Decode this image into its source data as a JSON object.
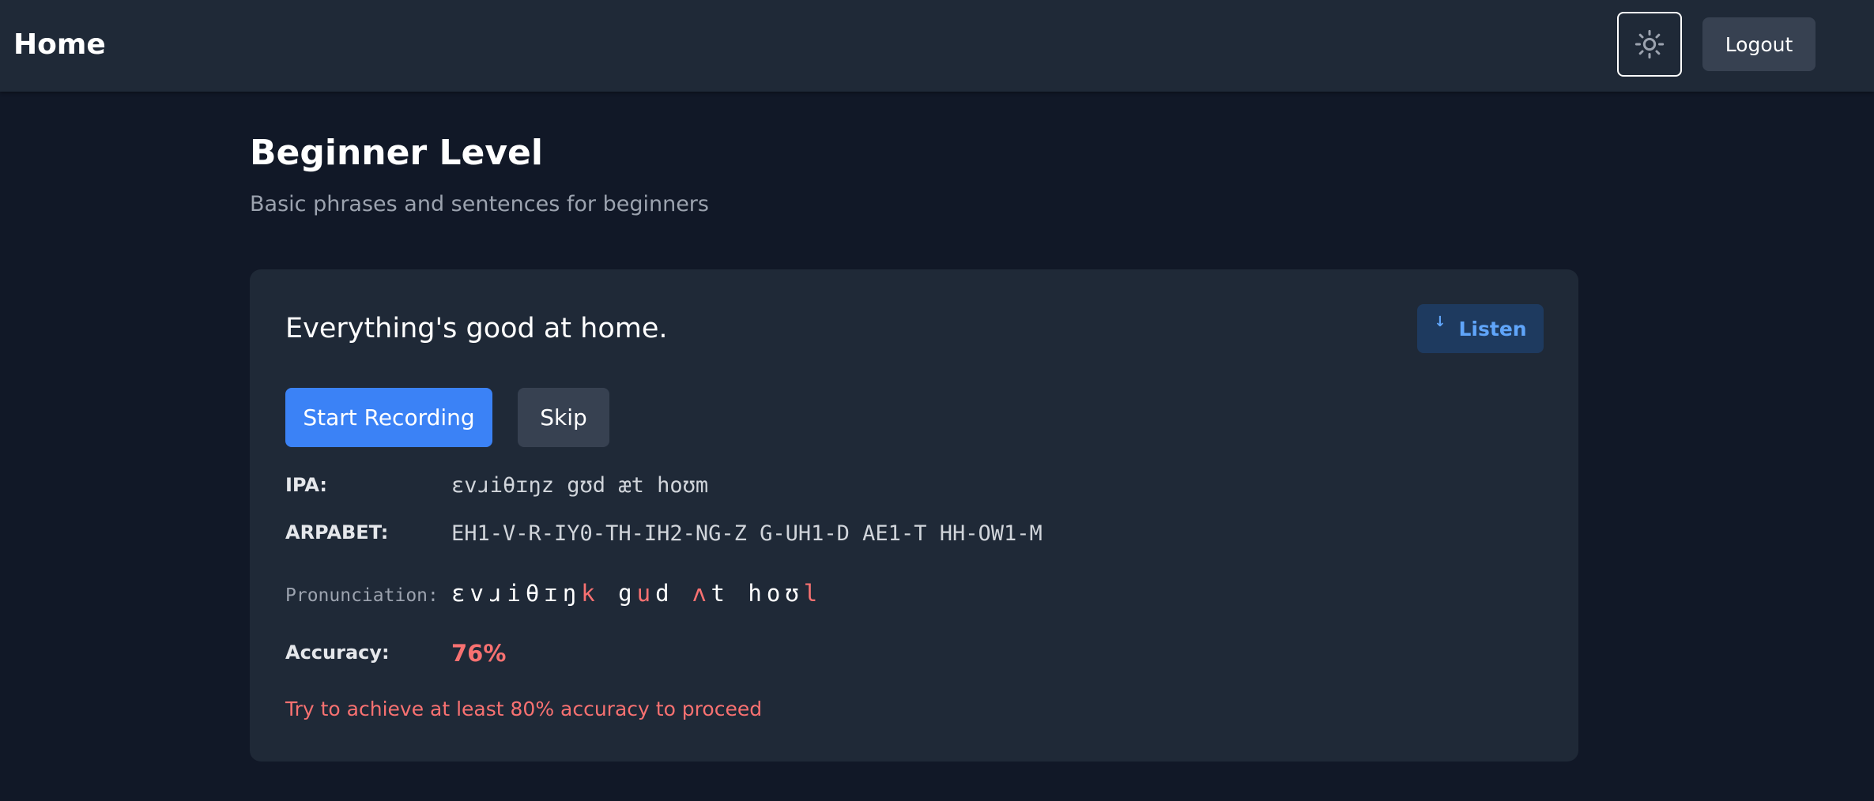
{
  "header": {
    "title": "Home",
    "theme_icon": "sun-icon",
    "logout_label": "Logout"
  },
  "level": {
    "title": "Beginner Level",
    "subtitle": "Basic phrases and sentences for beginners"
  },
  "exercise": {
    "sentence": "Everything's good at home.",
    "listen_label": "Listen",
    "listen_icon": "arrow-down-icon",
    "record_label": "Start Recording",
    "skip_label": "Skip",
    "ipa_label": "IPA:",
    "ipa_value": "ɛvɹiθɪŋz gʊd æt hoʊm",
    "arpabet_label": "ARPABET:",
    "arpabet_value": "EH1-V-R-IY0-TH-IH2-NG-Z G-UH1-D AE1-T HH-OW1-M",
    "pronunciation_label": "Pronunciation:",
    "pronunciation_segments": [
      {
        "text": "ɛvɹiθɪŋ",
        "correct": true
      },
      {
        "text": "k",
        "correct": false
      },
      {
        "text": " g",
        "correct": true
      },
      {
        "text": "u",
        "correct": false
      },
      {
        "text": "d ",
        "correct": true
      },
      {
        "text": "ʌ",
        "correct": false
      },
      {
        "text": "t hoʊ",
        "correct": true
      },
      {
        "text": "l",
        "correct": false
      }
    ],
    "accuracy_label": "Accuracy:",
    "accuracy_value": "76%",
    "hint": "Try to achieve at least 80% accuracy to proceed"
  },
  "colors": {
    "background": "#111827",
    "surface": "#1f2937",
    "primary": "#3b82f6",
    "error": "#f87171",
    "listen_text": "#60a5fa"
  }
}
